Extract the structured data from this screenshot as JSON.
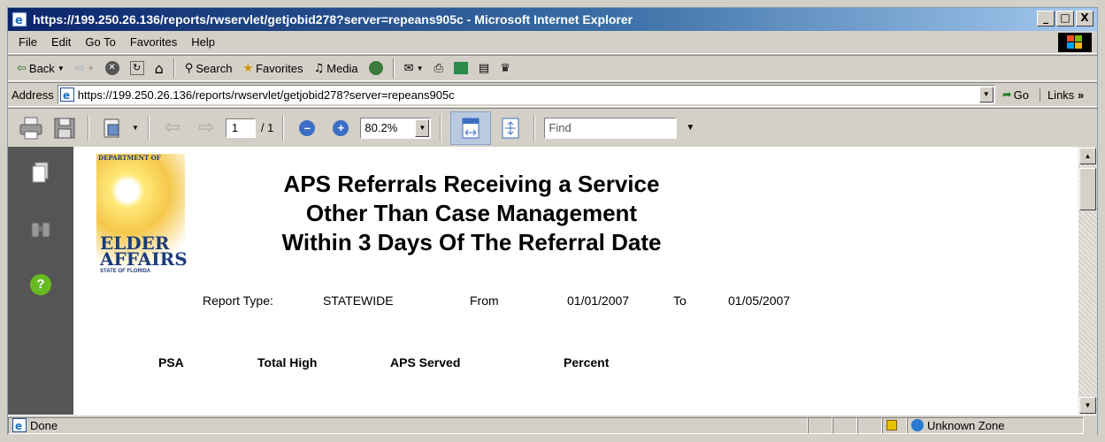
{
  "window": {
    "title": "https://199.250.26.136/reports/rwservlet/getjobid278?server=repeans905c - Microsoft Internet Explorer",
    "buttons": [
      "_",
      "□",
      "X"
    ]
  },
  "menu": [
    "File",
    "Edit",
    "Go To",
    "Favorites",
    "Help"
  ],
  "std_toolbar": {
    "back": "Back",
    "search": "Search",
    "favorites": "Favorites",
    "media": "Media"
  },
  "address": {
    "label": "Address",
    "url": "https://199.250.26.136/reports/rwservlet/getjobid278?server=repeans905c",
    "go": "Go",
    "links": "Links"
  },
  "viewer": {
    "page_current": "1",
    "page_total": "/ 1",
    "zoom": "80.2%",
    "find_placeholder": "Find"
  },
  "report": {
    "logo": {
      "dept": "DEPARTMENT OF",
      "line1": "ELDER",
      "line2": "AFFAIRS",
      "state": "STATE OF FLORIDA"
    },
    "title_lines": [
      "APS Referrals Receiving a Service",
      "Other Than Case Management",
      "Within 3 Days Of The Referral Date"
    ],
    "meta": {
      "report_type_label": "Report Type:",
      "report_type_value": "STATEWIDE",
      "from_label": "From",
      "from_value": "01/01/2007",
      "to_label": "To",
      "to_value": "01/05/2007"
    },
    "columns": [
      "PSA",
      "Total High",
      "APS Served",
      "Percent"
    ]
  },
  "status": {
    "text": "Done",
    "zone": "Unknown Zone"
  }
}
